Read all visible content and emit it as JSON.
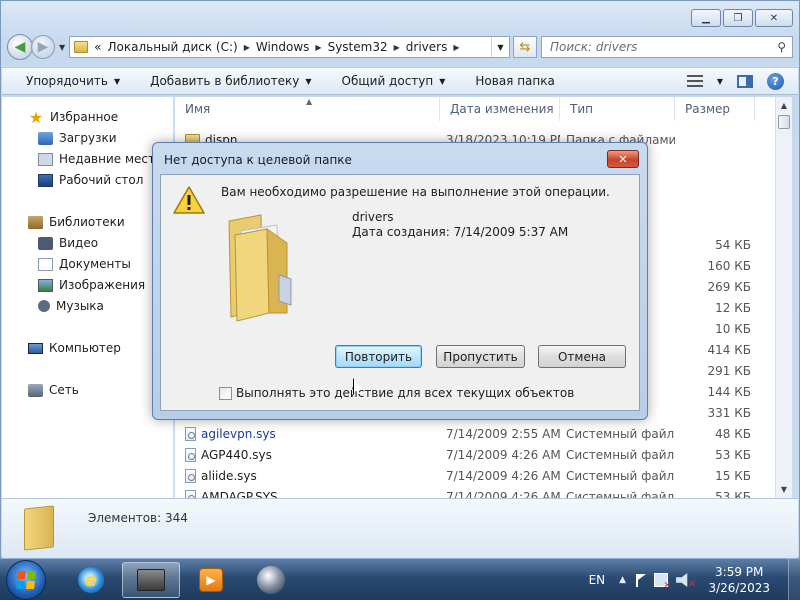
{
  "address": {
    "crumbs": [
      "Локальный диск (C:)",
      "Windows",
      "System32",
      "drivers"
    ],
    "overflow_glyph": "«",
    "search_placeholder": "Поиск: drivers"
  },
  "toolbar": {
    "organize": "Упорядочить",
    "add_to_library": "Добавить в библиотеку",
    "share": "Общий доступ",
    "new_folder": "Новая папка"
  },
  "navpane": {
    "favorites": "Избранное",
    "downloads": "Загрузки",
    "recent": "Недавние места",
    "desktop": "Рабочий стол",
    "libraries": "Библиотеки",
    "video": "Видео",
    "documents": "Документы",
    "pictures": "Изображения",
    "music": "Музыка",
    "computer": "Компьютер",
    "network": "Сеть"
  },
  "filelist": {
    "columns": {
      "name": "Имя",
      "date": "Дата изменения",
      "type": "Тип",
      "size": "Размер"
    },
    "rows": [
      {
        "name": "dispn",
        "date": "3/18/2023 10:19 PM",
        "type": "Папка с файлами",
        "size": "",
        "kind": "folder"
      },
      {
        "name": "",
        "date": "",
        "type": "",
        "size": "",
        "kind": "hidden"
      },
      {
        "name": "",
        "date": "",
        "type": "",
        "size": "",
        "kind": "hidden"
      },
      {
        "name": "",
        "date": "",
        "type": "",
        "size": "",
        "kind": "hidden"
      },
      {
        "name": "",
        "date": "",
        "type": "",
        "size": "",
        "kind": "hidden"
      },
      {
        "name": "",
        "date": "",
        "type": "",
        "size": "54 КБ",
        "kind": "hidden"
      },
      {
        "name": "",
        "date": "",
        "type": "",
        "size": "160 КБ",
        "kind": "hidden"
      },
      {
        "name": "",
        "date": "",
        "type": "",
        "size": "269 КБ",
        "kind": "hidden"
      },
      {
        "name": "",
        "date": "",
        "type": "",
        "size": "12 КБ",
        "kind": "hidden"
      },
      {
        "name": "",
        "date": "",
        "type": "",
        "size": "10 КБ",
        "kind": "hidden"
      },
      {
        "name": "",
        "date": "",
        "type": "",
        "size": "414 КБ",
        "kind": "hidden"
      },
      {
        "name": "",
        "date": "",
        "type": "",
        "size": "291 КБ",
        "kind": "hidden"
      },
      {
        "name": "",
        "date": "",
        "type": "",
        "size": "144 КБ",
        "kind": "hidden"
      },
      {
        "name": "",
        "date": "",
        "type": "",
        "size": "331 КБ",
        "kind": "hidden"
      },
      {
        "name": "agilevpn.sys",
        "date": "7/14/2009 2:55 AM",
        "type": "Системный файл",
        "size": "48 КБ",
        "kind": "file",
        "link": true
      },
      {
        "name": "AGP440.sys",
        "date": "7/14/2009 4:26 AM",
        "type": "Системный файл",
        "size": "53 КБ",
        "kind": "file"
      },
      {
        "name": "aliide.sys",
        "date": "7/14/2009 4:26 AM",
        "type": "Системный файл",
        "size": "15 КБ",
        "kind": "file"
      },
      {
        "name": "AMDAGP.SYS",
        "date": "7/14/2009 4:26 AM",
        "type": "Системный файл",
        "size": "53 КБ",
        "kind": "file"
      }
    ]
  },
  "details": {
    "count": "Элементов: 344"
  },
  "dialog": {
    "title": "Нет доступа к целевой папке",
    "message": "Вам необходимо разрешение на выполнение этой операции.",
    "file_name": "drivers",
    "file_created": "Дата создания: 7/14/2009 5:37 AM",
    "retry": "Повторить",
    "skip": "Пропустить",
    "cancel": "Отмена",
    "apply_all": "Выполнять это действие для всех текущих объектов"
  },
  "taskbar": {
    "lang": "EN",
    "time": "3:59 PM",
    "date": "3/26/2023"
  },
  "colors": {
    "link_text": "#1a3a9c",
    "close_red": "#c7432b",
    "default_button": "#bee6fd"
  }
}
